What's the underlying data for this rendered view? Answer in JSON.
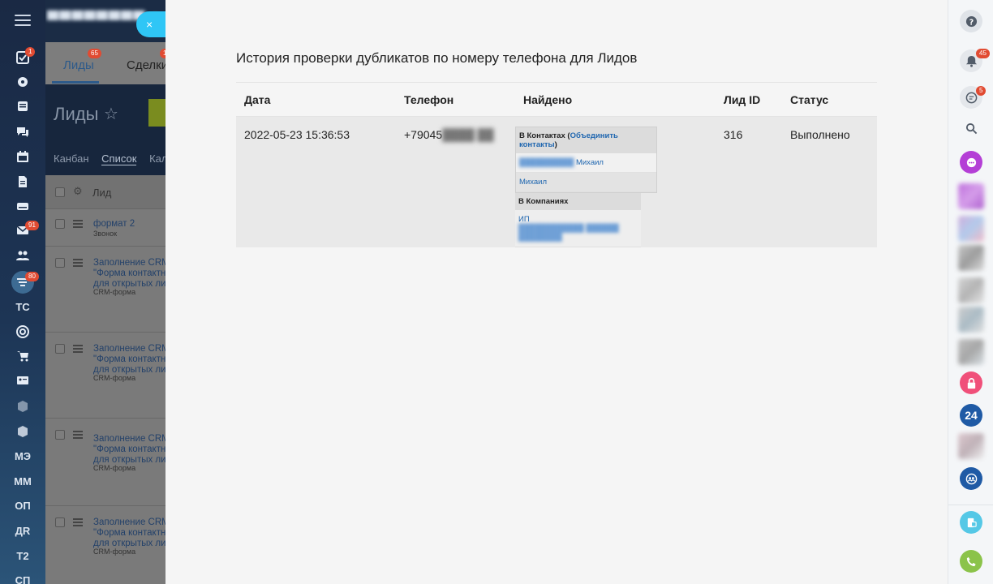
{
  "background_crm": {
    "portal_name": "▀▀▀▀▀▀▀▀ 2",
    "tabs": [
      {
        "label": "Лиды",
        "badge": "65"
      },
      {
        "label": "Сделки",
        "badge": "1"
      }
    ],
    "page_title": "Лиды",
    "add_button": "Д",
    "views": [
      "Канбан",
      "Список",
      "Кал"
    ],
    "column_header": "Лид",
    "rows": [
      {
        "title": "формат 2",
        "subtitle": "Звонок"
      },
      {
        "title": "Заполнение CRM\n\"Форма контактн\nдля открытых ли",
        "subtitle": "CRM-форма"
      },
      {
        "title": "Заполнение CRM\n\"Форма контактн\nдля открытых ли",
        "subtitle": "CRM-форма"
      },
      {
        "title": "Заполнение CRM\n\"Форма контактн\nдля открытых ли",
        "subtitle": "CRM-форма"
      },
      {
        "title": "Заполнение CRM\n\"Форма контактн\nдля открытых ли",
        "subtitle": "CRM-форма"
      }
    ]
  },
  "left_nav": {
    "badges": {
      "tasks": "1",
      "mail": "91",
      "crm": "80"
    },
    "text_items": [
      "ТС",
      "МЭ",
      "ММ",
      "ОП",
      "ДR",
      "Т2",
      "СП"
    ]
  },
  "panel": {
    "close_icon": "×",
    "title": "История проверки дубликатов по номеру телефона для Лидов",
    "columns": [
      "Дата",
      "Телефон",
      "Найдено",
      "Лид ID",
      "Статус"
    ],
    "row": {
      "date": "2022-05-23 15:36:53",
      "phone_prefix": "+79045",
      "phone_hidden": "████ ██",
      "lead_id": "316",
      "status": "Выполнено",
      "found": {
        "contacts_label": "В Контактах (",
        "merge_link": "Объединить контакты",
        "contacts_close": ")",
        "contacts": [
          {
            "hidden": "██████████",
            "name": "Михаил"
          },
          {
            "hidden": "",
            "name": "Михаил"
          }
        ],
        "companies_label": "В Компаниях",
        "company_prefix": "ИП",
        "company_hidden": "████████████ ██████ ████████"
      }
    }
  },
  "right_bar": {
    "badges": {
      "notifications": "45",
      "chat": "5"
    },
    "b24_label": "24"
  }
}
